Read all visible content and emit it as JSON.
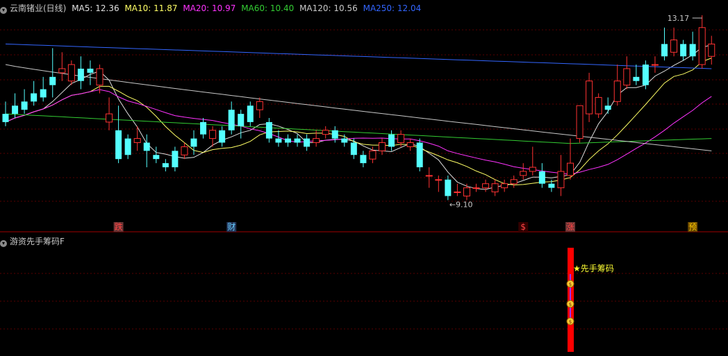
{
  "header": {
    "stock": "云南锗业(日线)",
    "ma": [
      {
        "text": "MA5: 12.36",
        "color": "#e0e0e0"
      },
      {
        "text": "MA10: 11.87",
        "color": "#ffff66"
      },
      {
        "text": "MA20: 10.97",
        "color": "#ff33ff"
      },
      {
        "text": "MA60: 10.40",
        "color": "#33cc33"
      },
      {
        "text": "MA120: 10.56",
        "color": "#c8c8c8"
      },
      {
        "text": "MA250: 12.04",
        "color": "#3366ff"
      }
    ]
  },
  "indicator": {
    "name": "游资先手筹码F",
    "signal_label": "★先手筹码",
    "signal_color": "#ff0000",
    "money_icon": "money-bag-icon"
  },
  "chart_data": {
    "type": "candlestick",
    "high_label": "13.17",
    "low_label": "←9.10",
    "ylim": [
      8.6,
      13.6
    ],
    "candles": [
      [
        11.2,
        11.0,
        11.5,
        10.9
      ],
      [
        11.4,
        11.2,
        11.7,
        11.1
      ],
      [
        11.5,
        11.3,
        11.8,
        11.2
      ],
      [
        11.7,
        11.5,
        12.0,
        11.4
      ],
      [
        11.8,
        11.6,
        12.1,
        11.5
      ],
      [
        12.1,
        11.9,
        12.8,
        11.6
      ],
      [
        12.2,
        12.3,
        12.7,
        12.0
      ],
      [
        12.0,
        12.4,
        12.5,
        11.9
      ],
      [
        12.3,
        12.0,
        12.6,
        11.8
      ],
      [
        12.3,
        12.2,
        12.5,
        11.9
      ],
      [
        11.9,
        12.3,
        12.4,
        11.7
      ],
      [
        11.0,
        11.2,
        11.6,
        10.8
      ],
      [
        10.8,
        10.1,
        11.4,
        10.0
      ],
      [
        10.6,
        10.2,
        10.7,
        10.1
      ],
      [
        10.5,
        10.6,
        10.9,
        10.3
      ],
      [
        10.5,
        10.3,
        10.7,
        9.9
      ],
      [
        10.2,
        10.1,
        10.4,
        10.0
      ],
      [
        10.0,
        9.9,
        10.1,
        9.8
      ],
      [
        10.3,
        9.9,
        10.4,
        9.8
      ],
      [
        10.2,
        10.4,
        10.5,
        10.1
      ],
      [
        10.6,
        10.4,
        10.8,
        10.2
      ],
      [
        11.0,
        10.7,
        11.1,
        10.6
      ],
      [
        10.6,
        10.8,
        10.9,
        10.4
      ],
      [
        10.8,
        10.5,
        10.9,
        10.4
      ],
      [
        11.3,
        10.8,
        11.5,
        10.7
      ],
      [
        11.2,
        10.9,
        11.3,
        10.6
      ],
      [
        11.4,
        11.0,
        11.5,
        10.9
      ],
      [
        11.3,
        11.5,
        11.6,
        11.1
      ],
      [
        11.0,
        10.6,
        11.1,
        10.5
      ],
      [
        10.6,
        10.5,
        10.8,
        10.4
      ],
      [
        10.6,
        10.5,
        10.7,
        10.4
      ],
      [
        10.6,
        10.5,
        10.7,
        10.4
      ],
      [
        10.6,
        10.4,
        10.7,
        10.3
      ],
      [
        10.5,
        10.6,
        10.8,
        10.4
      ],
      [
        10.7,
        10.8,
        10.9,
        10.6
      ],
      [
        10.8,
        10.6,
        10.9,
        10.5
      ],
      [
        10.6,
        10.5,
        10.7,
        10.4
      ],
      [
        10.5,
        10.2,
        10.6,
        10.1
      ],
      [
        10.2,
        10.0,
        10.3,
        9.9
      ],
      [
        10.1,
        10.3,
        10.4,
        10.0
      ],
      [
        10.3,
        10.5,
        10.6,
        10.2
      ],
      [
        10.7,
        10.4,
        10.8,
        10.3
      ],
      [
        10.5,
        10.7,
        10.8,
        10.4
      ],
      [
        10.4,
        10.5,
        10.6,
        10.3
      ],
      [
        10.5,
        9.9,
        10.6,
        9.8
      ],
      [
        9.7,
        9.7,
        9.9,
        9.4
      ],
      [
        9.6,
        9.6,
        9.7,
        9.3
      ],
      [
        9.6,
        9.2,
        9.7,
        9.1
      ],
      [
        9.3,
        9.3,
        9.5,
        9.2
      ],
      [
        9.2,
        9.4,
        9.5,
        9.1
      ],
      [
        9.4,
        9.4,
        9.5,
        9.3
      ],
      [
        9.4,
        9.5,
        9.6,
        9.3
      ],
      [
        9.3,
        9.5,
        9.6,
        9.2
      ],
      [
        9.4,
        9.5,
        9.6,
        9.3
      ],
      [
        9.5,
        9.6,
        9.7,
        9.4
      ],
      [
        9.7,
        9.8,
        10.0,
        9.6
      ],
      [
        9.8,
        9.9,
        10.4,
        9.7
      ],
      [
        9.8,
        9.5,
        10.0,
        9.4
      ],
      [
        9.5,
        9.4,
        9.6,
        9.3
      ],
      [
        9.4,
        9.8,
        10.2,
        9.2
      ],
      [
        9.7,
        10.0,
        10.6,
        9.6
      ],
      [
        10.6,
        11.4,
        11.4,
        10.5
      ],
      [
        11.2,
        12.0,
        12.2,
        11.0
      ],
      [
        11.2,
        11.6,
        11.7,
        11.1
      ],
      [
        11.4,
        11.3,
        11.6,
        11.2
      ],
      [
        11.5,
        12.0,
        12.4,
        11.4
      ],
      [
        11.9,
        12.3,
        12.6,
        11.8
      ],
      [
        12.1,
        12.0,
        12.4,
        11.9
      ],
      [
        12.4,
        11.9,
        12.5,
        11.8
      ],
      [
        12.4,
        12.4,
        12.6,
        12.2
      ],
      [
        12.9,
        12.6,
        13.3,
        12.5
      ],
      [
        12.7,
        13.0,
        13.3,
        12.6
      ],
      [
        12.9,
        12.6,
        13.0,
        12.5
      ],
      [
        12.9,
        12.6,
        13.2,
        12.5
      ],
      [
        12.4,
        13.3,
        13.6,
        12.3
      ],
      [
        12.6,
        12.9,
        13.1,
        12.4
      ]
    ],
    "markers": [
      {
        "i": 12,
        "text": "跌",
        "color": "#ff4444",
        "bg": "#663333"
      },
      {
        "i": 24,
        "text": "财",
        "color": "#66ccff",
        "bg": "#223355"
      },
      {
        "i": 55,
        "text": "$",
        "color": "#ff4444",
        "bg": "#330000"
      },
      {
        "i": 60,
        "text": "涨",
        "color": "#ff4444",
        "bg": "#663333"
      },
      {
        "i": 73,
        "text": "预",
        "color": "#ffcc00",
        "bg": "#664400"
      }
    ],
    "signal_index": 60
  }
}
